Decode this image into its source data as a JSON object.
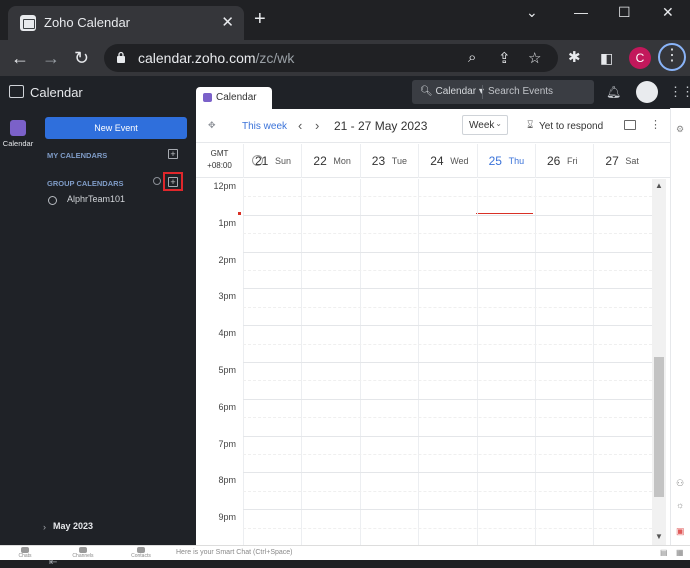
{
  "browser": {
    "tab_title": "Zoho Calendar",
    "url_host": "calendar.zoho.com",
    "url_path": "/zc/wk",
    "profile_initial": "C"
  },
  "app": {
    "title": "Calendar",
    "tab_label": "Calendar",
    "search_scope": "Calendar",
    "search_placeholder": "Search Events",
    "rail_label": "Calendar"
  },
  "sidebar": {
    "new_event": "New Event",
    "my_calendars": "MY CALENDARS",
    "group_calendars": "GROUP CALENDARS",
    "group_items": [
      "AlphrTeam101"
    ],
    "mini_month": "May 2023"
  },
  "toolbar": {
    "this_week": "This week",
    "range": "21 - 27 May 2023",
    "view": "Week",
    "yet_to_respond": "Yet to respond"
  },
  "timezone": {
    "label": "GMT",
    "offset": "+08:00"
  },
  "days": [
    {
      "num": "21",
      "name": "Sun",
      "today": false
    },
    {
      "num": "22",
      "name": "Mon",
      "today": false
    },
    {
      "num": "23",
      "name": "Tue",
      "today": false
    },
    {
      "num": "24",
      "name": "Wed",
      "today": false
    },
    {
      "num": "25",
      "name": "Thu",
      "today": true
    },
    {
      "num": "26",
      "name": "Fri",
      "today": false
    },
    {
      "num": "27",
      "name": "Sat",
      "today": false
    }
  ],
  "hours": [
    "12pm",
    "1pm",
    "2pm",
    "3pm",
    "4pm",
    "5pm",
    "6pm",
    "7pm",
    "8pm",
    "9pm"
  ],
  "bottom_bar": {
    "items": [
      "Chats",
      "Channels",
      "Contacts"
    ],
    "smart_chat": "Here is your Smart Chat (Ctrl+Space)"
  },
  "colors": {
    "accent": "#2f6fdc",
    "today": "#3b73d9",
    "now_line": "#d93025",
    "highlight": "#e0272b"
  }
}
